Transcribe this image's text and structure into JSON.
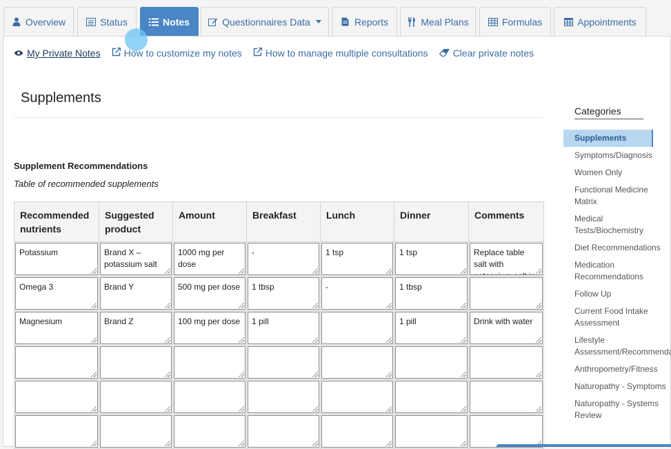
{
  "tabs": [
    {
      "label": "Overview",
      "icon": "user-icon"
    },
    {
      "label": "Status",
      "icon": "list-alt-icon"
    },
    {
      "label": "Notes",
      "icon": "list-icon",
      "active": true
    },
    {
      "label": "Questionnaires Data",
      "icon": "edit-icon",
      "dropdown": true
    },
    {
      "label": "Reports",
      "icon": "file-icon"
    },
    {
      "label": "Meal Plans",
      "icon": "cutlery-icon"
    },
    {
      "label": "Formulas",
      "icon": "table-icon"
    },
    {
      "label": "Appointments",
      "icon": "calendar-icon"
    }
  ],
  "links": {
    "private_notes": "My Private Notes",
    "customize": "How to customize my notes",
    "multiple": "How to manage multiple consultations",
    "clear": "Clear private notes"
  },
  "section": {
    "title": "Supplements",
    "subtitle": "Supplement Recommendations",
    "description": "Table of recommended supplements"
  },
  "table": {
    "headers": [
      "Recommended nutrients",
      "Suggested product",
      "Amount",
      "Breakfast",
      "Lunch",
      "Dinner",
      "Comments"
    ],
    "rows": [
      [
        "Potassium",
        "Brand X – potassium salt",
        "1000 mg per dose",
        "-",
        "1 tsp",
        "1 tsp",
        "Replace table salt with potassium salt in meals"
      ],
      [
        "Omega 3",
        "Brand Y",
        "500 mg per dose",
        "1 tbsp",
        "-",
        "1 tbsp",
        ""
      ],
      [
        "Magnesium",
        "Brand Z",
        "100 mg per dose",
        "1 pill",
        "",
        "1 pill",
        "Drink with water"
      ],
      [
        "",
        "",
        "",
        "",
        "",
        "",
        ""
      ],
      [
        "",
        "",
        "",
        "",
        "",
        "",
        ""
      ],
      [
        "",
        "",
        "",
        "",
        "",
        "",
        ""
      ]
    ]
  },
  "categories": {
    "heading": "Categories",
    "items": [
      "Supplements",
      "Symptoms/Diagnosis",
      "Women Only",
      "Functional Medicine Matrix",
      "Medical Tests/Biochemistry",
      "Diet Recommendations",
      "Medication Recommendations",
      "Follow Up",
      "Current Food Intake Assessment",
      "Lifestyle Assessment/Recommendations",
      "Anthropometry/Fitness",
      "Naturopathy - Symptoms",
      "Naturopathy - Systems Review"
    ]
  },
  "colors": {
    "accent": "#4a86c5",
    "link": "#3a6ea5",
    "active_category_bg": "#b7d6f0"
  }
}
